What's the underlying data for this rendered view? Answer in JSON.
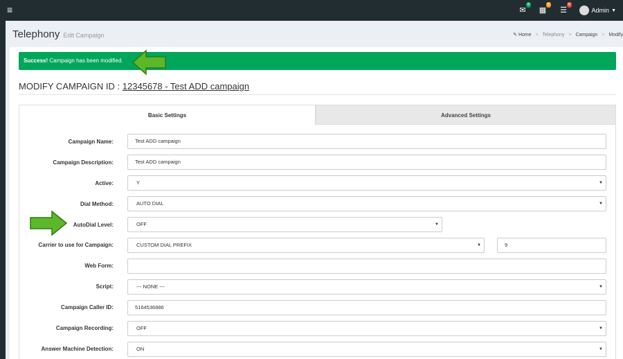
{
  "topbar": {
    "menu_glyph": "≡",
    "icons": [
      {
        "name": "mail-icon",
        "glyph": "✉",
        "badge": "0",
        "badge_color": "#00a65a"
      },
      {
        "name": "calendar-icon",
        "glyph": "▦",
        "badge": "0",
        "badge_color": "#f39c12"
      },
      {
        "name": "tasks-icon",
        "glyph": "☰",
        "badge": "0",
        "badge_color": "#dd4b39"
      }
    ],
    "user": "Admin"
  },
  "header": {
    "title": "Telephony",
    "subtitle": "Edit Campaign",
    "breadcrumb": {
      "home": "Home",
      "b1": "Telephony",
      "b2": "Campaign",
      "b3": "Modify"
    }
  },
  "alert": {
    "strong": "Success!",
    "message": "Campaign has been modified."
  },
  "campaign": {
    "title_prefix": "MODIFY CAMPAIGN ID : ",
    "title_link": "12345678 - Test ADD campaign"
  },
  "tabs": {
    "basic": "Basic Settings",
    "advanced": "Advanced Settings"
  },
  "form": {
    "campaign_name": {
      "label": "Campaign Name:",
      "value": "Test ADD campaign"
    },
    "campaign_description": {
      "label": "Campaign Description:",
      "value": "Test ADD campaign"
    },
    "active": {
      "label": "Active:",
      "value": "Y"
    },
    "dial_method": {
      "label": "Dial Method:",
      "value": "AUTO DIAL"
    },
    "autodial_level": {
      "label": "AutoDial Level:",
      "value": "OFF"
    },
    "carrier": {
      "label": "Carrier to use for Campaign:",
      "value": "CUSTOM DIAL PREFIX",
      "prefix": "9"
    },
    "web_form": {
      "label": "Web Form:",
      "value": ""
    },
    "script": {
      "label": "Script:",
      "value": "--- NONE ---"
    },
    "caller_id": {
      "label": "Campaign Caller ID:",
      "value": "5164536886"
    },
    "recording": {
      "label": "Campaign Recording:",
      "value": "OFF"
    },
    "amd": {
      "label": "Answer Machine Detection:",
      "value": "ON"
    }
  },
  "colors": {
    "navbar": "#222d32",
    "success": "#00a65a",
    "arrow": "#5cb82a"
  }
}
